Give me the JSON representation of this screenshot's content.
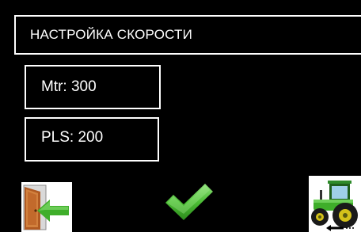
{
  "screen": {
    "title": "НАСТРОЙКА СКОРОСТИ",
    "background_color": "#000000",
    "foreground_color": "#ffffff"
  },
  "params": {
    "mtr": "Mtr: 300",
    "pls": "PLS: 200"
  },
  "buttons": {
    "exit_icon": "exit-door-arrow-icon",
    "confirm_icon": "green-checkmark-icon",
    "tractor_icon": "green-tractor-back-arrow-icon"
  },
  "colors": {
    "accent_green": "#3fae2a",
    "door_brown": "#a0522d"
  }
}
